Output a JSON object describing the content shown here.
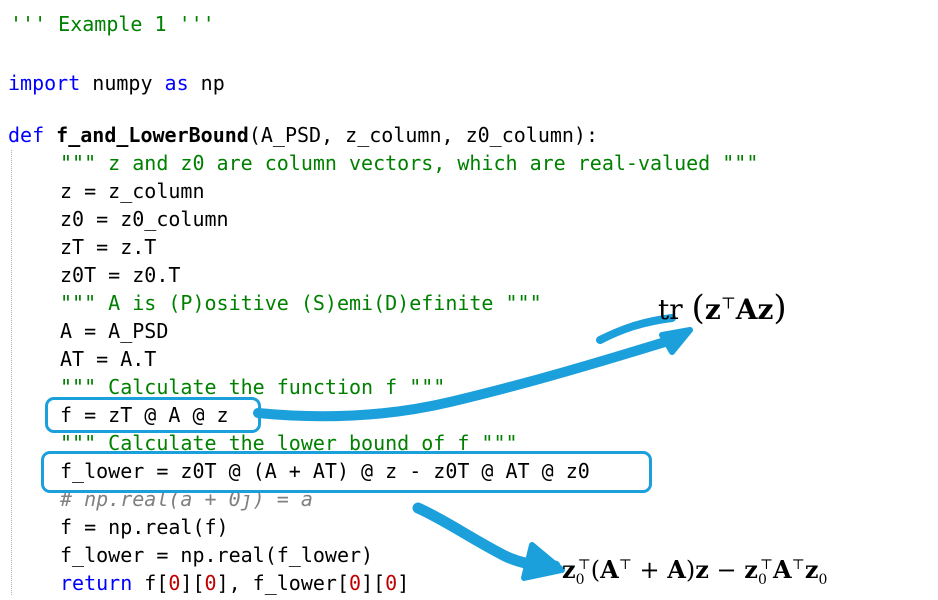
{
  "code": {
    "header_comment": "''' Example 1 '''",
    "import_kw": "import",
    "import_module": " numpy ",
    "import_as_kw": "as",
    "import_alias": " np",
    "def_kw": "def",
    "func_name": "f_and_LowerBound",
    "func_params": "(A_PSD, z_column, z0_column):",
    "docstring_1": "\"\"\" z and z0 are column vectors, which are real-valued \"\"\"",
    "line_z": "z = z_column",
    "line_z0": "z0 = z0_column",
    "line_zT": "zT = z.T",
    "line_z0T": "z0T = z0.T",
    "docstring_2": "\"\"\" A is (P)ositive (S)emi(D)efinite \"\"\"",
    "line_A": "A = A_PSD",
    "line_AT": "AT = A.T",
    "docstring_3": "\"\"\" Calculate the function f \"\"\"",
    "line_f": "f = zT @ A @ z",
    "docstring_4": "\"\"\" Calculate the lower bound of f \"\"\"",
    "line_f_lower": "f_lower = z0T @ (A + AT) @ z - z0T @ AT @ z0",
    "comment_real": "# np.real(a + 0j) = a",
    "line_f_real": "f = np.real(f)",
    "line_f_lower_real": "f_lower = np.real(f_lower)",
    "return_kw": "return",
    "return_part1": " f[",
    "return_idx1": "0",
    "return_part2": "][",
    "return_idx2": "0",
    "return_part3": "], f_lower[",
    "return_idx3": "0",
    "return_part4": "][",
    "return_idx4": "0",
    "return_part5": "]"
  },
  "annotations": {
    "trace_formula": {
      "op": "tr",
      "lparen": "(",
      "z": "z",
      "sup_T": "⊤",
      "A": "A",
      "z2": "z",
      "rparen": ")"
    },
    "lower_bound_formula": {
      "z0a": "z",
      "sub0a": "0",
      "supTa": "⊤",
      "lp": "(",
      "A1": "A",
      "supT1": "⊤",
      "plus": " + ",
      "A2": "A",
      "rp": ")",
      "z1": "z",
      "minus": " − ",
      "z0b": "z",
      "sub0b": "0",
      "supTb": "⊤",
      "A3": "A",
      "supT3": "⊤",
      "z0c": "z",
      "sub0c": "0"
    },
    "accent_color": "#1ca0dc"
  }
}
